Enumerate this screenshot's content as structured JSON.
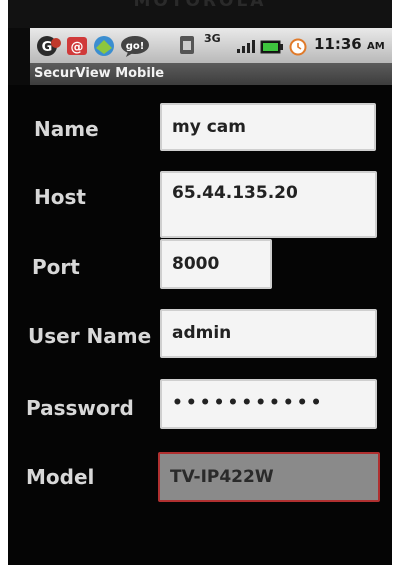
{
  "device": {
    "brand": "MOTOROLA"
  },
  "statusbar": {
    "notification_icons": [
      "gmail-icon",
      "email-icon",
      "market-icon",
      "talk-icon"
    ],
    "network": "3G",
    "time": "11:36",
    "ampm": "AM"
  },
  "app": {
    "title": "SecurView Mobile"
  },
  "form": {
    "name_label": "Name",
    "name_value": "my cam",
    "host_label": "Host",
    "host_value": "65.44.135.20",
    "port_label": "Port",
    "port_value": "8000",
    "user_label": "User Name",
    "user_value": "admin",
    "password_label": "Password",
    "password_value": "•••••••••••",
    "model_label": "Model",
    "model_value": "TV-IP422W"
  }
}
